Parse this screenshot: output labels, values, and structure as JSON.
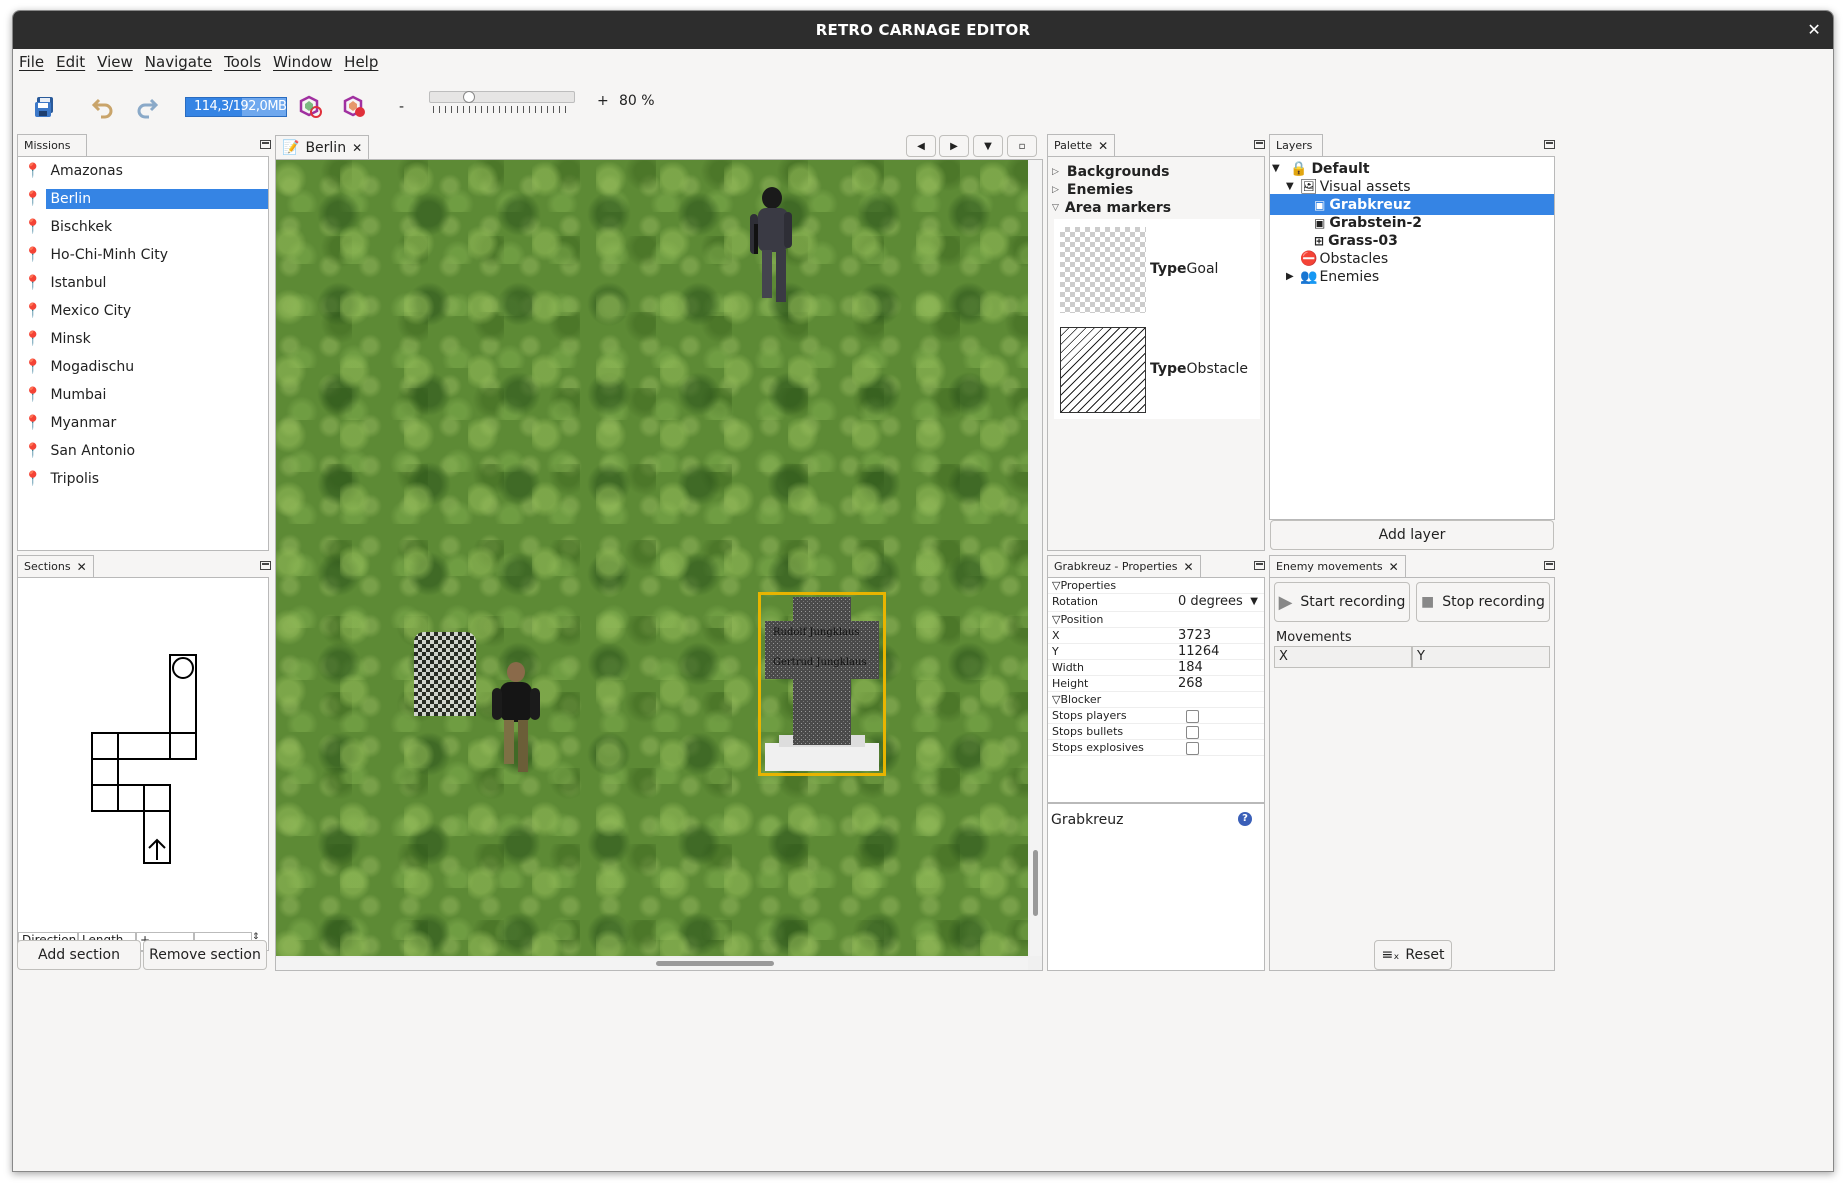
{
  "window": {
    "title": "RETRO CARNAGE EDITOR"
  },
  "menu": [
    "File",
    "Edit",
    "View",
    "Navigate",
    "Tools",
    "Window",
    "Help"
  ],
  "toolbar": {
    "memory": "114,3/192,0MB",
    "zoom_minus": "-",
    "zoom_plus": "+",
    "zoom_value": "80 %",
    "zoom_fraction": 0.25
  },
  "missions": {
    "title": "Missions",
    "items": [
      "Amazonas",
      "Berlin",
      "Bischkek",
      "Ho-Chi-Minh City",
      "Istanbul",
      "Mexico City",
      "Minsk",
      "Mogadischu",
      "Mumbai",
      "Myanmar",
      "San Antonio",
      "Tripolis"
    ],
    "selected": "Berlin"
  },
  "sections": {
    "title": "Sections",
    "columns": [
      "Direction",
      "Length",
      "+",
      "-"
    ],
    "add": "Add section",
    "remove": "Remove section"
  },
  "editor": {
    "tab": "Berlin",
    "tombstone_lines": [
      "Rudolf Jungklaus",
      "Gertrud Jungklaus"
    ]
  },
  "palette": {
    "title": "Palette",
    "groups": [
      "Backgrounds",
      "Enemies",
      "Area markers"
    ],
    "items": [
      {
        "key": "Type",
        "value": "Goal"
      },
      {
        "key": "Type",
        "value": "Obstacle"
      }
    ]
  },
  "layers": {
    "title": "Layers",
    "root": "Default",
    "visual_assets": "Visual assets",
    "assets": [
      "Grabkreuz",
      "Grabstein-2",
      "Grass-03"
    ],
    "obstacles": "Obstacles",
    "enemies": "Enemies",
    "add": "Add layer"
  },
  "properties": {
    "title": "Grabkreuz - Properties",
    "group_props": "Properties",
    "rotation_label": "Rotation",
    "rotation": "0 degrees",
    "group_pos": "Position",
    "x_label": "X",
    "x": "3723",
    "y_label": "Y",
    "y": "11264",
    "w_label": "Width",
    "w": "184",
    "h_label": "Height",
    "h": "268",
    "group_blocker": "Blocker",
    "stops_players": "Stops players",
    "stops_bullets": "Stops bullets",
    "stops_explosives": "Stops explosives",
    "description_title": "Grabkreuz"
  },
  "enemy_movements": {
    "title": "Enemy movements",
    "start": "Start recording",
    "stop": "Stop recording",
    "movements": "Movements",
    "col_x": "X",
    "col_y": "Y",
    "reset": "Reset"
  },
  "colors": {
    "accent": "#3584e4",
    "selection_box": "#e8b400",
    "titlebar": "#2d2d2d"
  }
}
